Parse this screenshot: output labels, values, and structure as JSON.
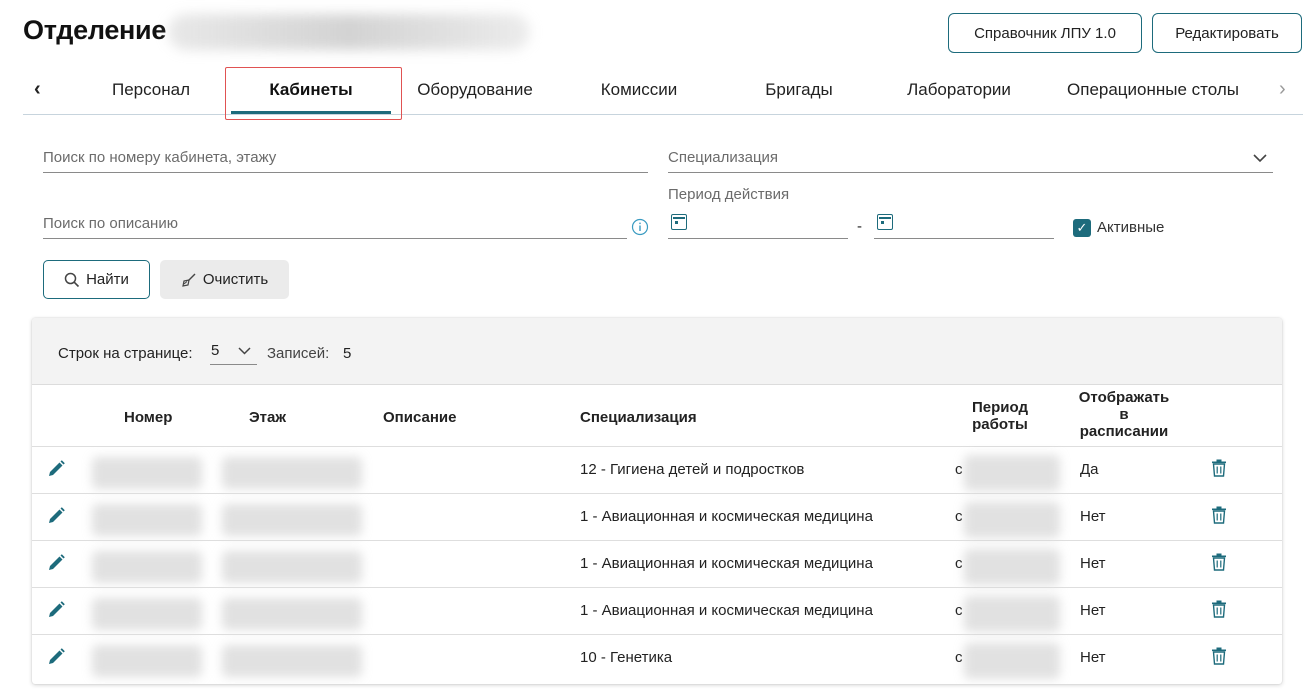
{
  "header": {
    "title": "Отделение",
    "buttons": {
      "reference": "Справочник ЛПУ 1.0",
      "edit": "Редактировать"
    }
  },
  "tabs": [
    {
      "label": "Персонал"
    },
    {
      "label": "Кабинеты",
      "active": true
    },
    {
      "label": "Оборудование"
    },
    {
      "label": "Комиссии"
    },
    {
      "label": "Бригады"
    },
    {
      "label": "Лаборатории"
    },
    {
      "label": "Операционные столы"
    }
  ],
  "filters": {
    "search_room_placeholder": "Поиск по номеру кабинета, этажу",
    "specialization_placeholder": "Специализация",
    "description_placeholder": "Поиск по описанию",
    "period_label": "Период действия",
    "period_separator": "-",
    "active_label": "Активные",
    "active_checked": true,
    "find_button": "Найти",
    "clear_button": "Очистить"
  },
  "table": {
    "rows_per_page_label": "Строк на странице:",
    "rows_per_page": "5",
    "records_label": "Записей:",
    "records_count": "5",
    "columns": {
      "number": "Номер",
      "floor": "Этаж",
      "description": "Описание",
      "specialization": "Специализация",
      "period": "Период работы",
      "show_in_schedule": "Отображать в расписании"
    },
    "rows": [
      {
        "specialization": "12 - Гигиена детей и подростков",
        "period_prefix": "с",
        "show": "Да"
      },
      {
        "specialization": "1 - Авиационная и космическая медицина",
        "period_prefix": "с",
        "show": "Нет"
      },
      {
        "specialization": "1 - Авиационная и космическая медицина",
        "period_prefix": "с",
        "show": "Нет"
      },
      {
        "specialization": "1 - Авиационная и космическая медицина",
        "period_prefix": "с",
        "show": "Нет"
      },
      {
        "specialization": "10 - Генетика",
        "period_prefix": "с",
        "show": "Нет"
      }
    ]
  },
  "colors": {
    "accent": "#1d6b7c",
    "highlight": "#e05252"
  }
}
